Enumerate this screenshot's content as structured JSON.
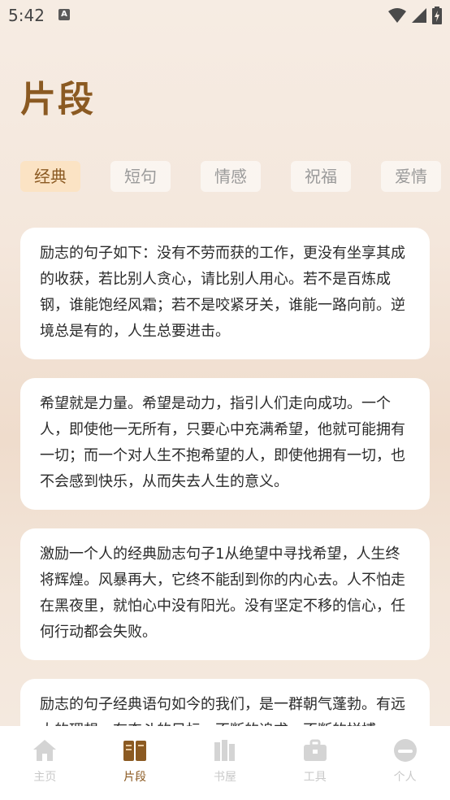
{
  "status": {
    "time": "5:42",
    "notification_icon_letter": "A"
  },
  "page": {
    "title": "片段"
  },
  "tabs": [
    {
      "label": "经典",
      "active": true
    },
    {
      "label": "短句",
      "active": false
    },
    {
      "label": "情感",
      "active": false
    },
    {
      "label": "祝福",
      "active": false
    },
    {
      "label": "爱情",
      "active": false
    }
  ],
  "cards": [
    {
      "text": "励志的句子如下：没有不劳而获的工作，更没有坐享其成的收获，若比别人贪心，请比别人用心。若不是百炼成钢，谁能饱经风霜；若不是咬紧牙关，谁能一路向前。逆境总是有的，人生总要进击。"
    },
    {
      "text": "希望就是力量。希望是动力，指引人们走向成功。一个人，即使他一无所有，只要心中充满希望，他就可能拥有一切；而一个对人生不抱希望的人，即使他拥有一切，也不会感到快乐，从而失去人生的意义。"
    },
    {
      "text": "激励一个人的经典励志句子1从绝望中寻找希望，人生终将辉煌。风暴再大，它终不能刮到你的内心去。人不怕走在黑夜里，就怕心中没有阳光。没有坚定不移的信心，任何行动都会失败。"
    },
    {
      "text": "励志的句子经典语句如今的我们，是一群朝气蓬勃。有远大的理想、有奋斗的目标，不断的追求、不断的拼搏"
    }
  ],
  "bottom_nav": [
    {
      "label": "主页",
      "icon": "home-icon",
      "active": false
    },
    {
      "label": "片段",
      "icon": "book-icon",
      "active": true
    },
    {
      "label": "书屋",
      "icon": "bookshelf-icon",
      "active": false
    },
    {
      "label": "工具",
      "icon": "toolbox-icon",
      "active": false
    },
    {
      "label": "个人",
      "icon": "profile-icon",
      "active": false
    }
  ],
  "colors": {
    "accent": "#8b5a22",
    "active_tab_bg": "#fbe3c4",
    "inactive": "#c9c9c9"
  }
}
